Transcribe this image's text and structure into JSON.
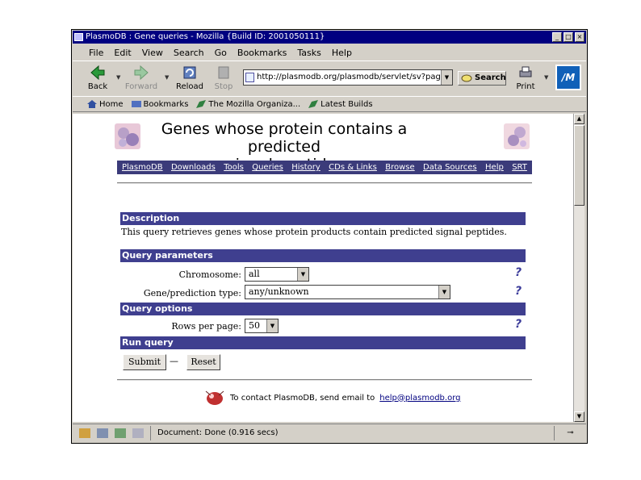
{
  "window": {
    "title": "PlasmoDB : Gene queries - Mozilla {Build ID: 2001050111}"
  },
  "menu": [
    "File",
    "Edit",
    "View",
    "Search",
    "Go",
    "Bookmarks",
    "Tasks",
    "Help"
  ],
  "nav": {
    "back": "Back",
    "forward": "Forward",
    "reload": "Reload",
    "stop": "Stop",
    "url": "http://plasmodb.org/plasmodb/servlet/sv?page=ge",
    "search": "Search",
    "print": "Print"
  },
  "personal": [
    "Home",
    "Bookmarks",
    "The Mozilla Organiza...",
    "Latest Builds"
  ],
  "page": {
    "title_line1": "Genes whose protein contains a predicted",
    "title_line2": "signal peptide.",
    "links": [
      "PlasmoDB",
      "Downloads",
      "Tools",
      "Queries",
      "History",
      "CDs & Links",
      "Browse",
      "Data Sources",
      "Help",
      "SRT"
    ],
    "description_head": "Description",
    "description_text": "This query retrieves genes whose protein products contain predicted signal peptides.",
    "params_head": "Query parameters",
    "chromosome_label": "Chromosome:",
    "chromosome_value": "all",
    "genetype_label": "Gene/prediction type:",
    "genetype_value": "any/unknown",
    "options_head": "Query options",
    "rows_label": "Rows per page:",
    "rows_value": "50",
    "run_head": "Run query",
    "submit": "Submit",
    "dash": "—",
    "reset": "Reset",
    "help_mark": "?",
    "contact_text": "To contact PlasmoDB, send email to",
    "contact_email": "help@plasmodb.org"
  },
  "status": {
    "text": "Document: Done (0.916 secs)"
  },
  "colors": {
    "title_bar": "#000080",
    "section_head": "#3f3f8f",
    "nav_links_bg": "#3b3b7a",
    "help_mark": "#3b3b9a"
  }
}
